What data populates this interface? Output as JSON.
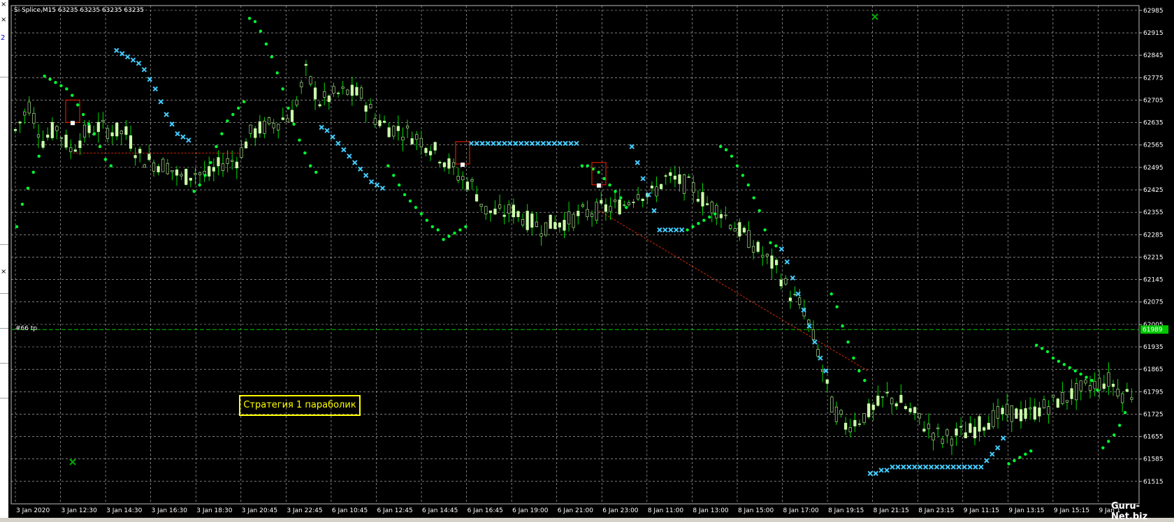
{
  "window": {
    "title": "Si Splice,M15  63235 63235 63235 63235"
  },
  "annotations": {
    "strategy_label": "Стратегия 1 параболик",
    "tp_label": "#66 tp",
    "current_price": "61989",
    "watermark": "Guru-Net.biz"
  },
  "left_strip": {
    "close_marks": [
      "×",
      "×",
      "×"
    ],
    "link_text": "2"
  },
  "colors": {
    "background": "#000000",
    "grid": "#c8c8c8",
    "bull_candle": "#ccffaa",
    "wick": "#00dd00",
    "sar_green": "#00ff33",
    "sar_cyan": "#44ccff",
    "tp_line": "#00c800",
    "order_line": "#ff3300",
    "label_yellow": "#ffff00"
  },
  "chart_data": {
    "type": "candlestick",
    "symbol": "Si Splice",
    "timeframe": "M15",
    "ohlc_header": [
      63235,
      63235,
      63235,
      63235
    ],
    "y_ticks": [
      62985,
      62915,
      62845,
      62775,
      62705,
      62635,
      62565,
      62495,
      62425,
      62355,
      62285,
      62215,
      62145,
      62075,
      62005,
      61935,
      61865,
      61795,
      61725,
      61655,
      61585,
      61515
    ],
    "ylim": [
      61445,
      63000
    ],
    "x_ticks": [
      "3 Jan 2020",
      "3 Jan 12:30",
      "3 Jan 14:30",
      "3 Jan 16:30",
      "3 Jan 18:30",
      "3 Jan 20:45",
      "3 Jan 22:45",
      "6 Jan 10:45",
      "6 Jan 12:45",
      "6 Jan 14:45",
      "6 Jan 16:45",
      "6 Jan 19:00",
      "6 Jan 21:00",
      "6 Jan 23:00",
      "8 Jan 11:00",
      "8 Jan 13:00",
      "8 Jan 15:00",
      "8 Jan 17:00",
      "8 Jan 19:15",
      "8 Jan 21:15",
      "8 Jan 23:15",
      "9 Jan 11:15",
      "9 Jan 13:15",
      "9 Jan 15:15",
      "9 Jan 1"
    ],
    "tp_level": 61989,
    "close_path": [
      62610,
      62690,
      62580,
      62620,
      62550,
      62600,
      62620,
      62610,
      62600,
      62530,
      62510,
      62500,
      62460,
      62480,
      62470,
      62510,
      62520,
      62600,
      62620,
      62640,
      62660,
      62790,
      62700,
      62720,
      62730,
      62720,
      62650,
      62620,
      62610,
      62590,
      62560,
      62520,
      62470,
      62440,
      62360,
      62350,
      62360,
      62330,
      62310,
      62320,
      62330,
      62350,
      62360,
      62370,
      62380,
      62420,
      62410,
      62460,
      62450,
      62430,
      62380,
      62360,
      62310,
      62270,
      62220,
      62180,
      62100,
      62050,
      61920,
      61750,
      61690,
      61710,
      61740,
      61780,
      61760,
      61720,
      61680,
      61650,
      61660,
      61670,
      61700,
      61720,
      61730,
      61720,
      61740,
      61760,
      61780,
      61800,
      61820,
      61830,
      61790
    ],
    "sar_green_segments": [
      [
        [
          62310,
          62380,
          62430,
          62480,
          62530
        ]
      ],
      [
        [
          62780,
          62770,
          62760,
          62750,
          62740,
          62720,
          62690,
          62660,
          62630,
          62600,
          62560,
          62520,
          62500
        ]
      ],
      [
        [
          62420,
          62440,
          62470,
          62510,
          62560,
          62600,
          62640,
          62660,
          62680,
          62700
        ]
      ],
      [
        [
          62960,
          62950,
          62920,
          62880,
          62840,
          62790,
          62740,
          62680,
          62630,
          62580,
          62540,
          62500,
          62480
        ]
      ],
      [
        [
          62500,
          62470,
          62440,
          62410,
          62390,
          62370,
          62350,
          62330,
          62310,
          62300
        ]
      ],
      [
        [
          62270,
          62280,
          62290,
          62300,
          62310
        ]
      ],
      [
        [
          62500,
          62500,
          62490,
          62480,
          62460,
          62440,
          62420,
          62400,
          62370
        ]
      ],
      [
        [
          62300,
          62310,
          62320,
          62330,
          62340,
          62350
        ]
      ],
      [
        [
          62560,
          62550,
          62530,
          62500,
          62470,
          62440,
          62400,
          62360,
          62300,
          62260,
          62250
        ]
      ],
      [
        [
          62100,
          62060,
          62000,
          61950,
          61900,
          61860,
          61830
        ]
      ],
      [
        [
          61570,
          61580,
          61590,
          61600,
          61610
        ]
      ],
      [
        [
          61940,
          61930,
          61920,
          61900,
          61890,
          61880,
          61870,
          61860,
          61850,
          61840,
          61830,
          61800
        ]
      ],
      [
        [
          61620,
          61640,
          61660,
          61690,
          61730
        ]
      ]
    ],
    "sar_cyan_segments": [
      [
        62860,
        62850,
        62840,
        62830,
        62820,
        62800,
        62770,
        62740,
        62700,
        62660,
        62630,
        62600,
        62590,
        62580
      ],
      [
        62620,
        62610,
        62590,
        62570,
        62550,
        62530,
        62510,
        62490,
        62470,
        62450,
        62440,
        62430
      ],
      [
        62570,
        62570,
        62570,
        62570,
        62570,
        62570,
        62570,
        62570,
        62570,
        62570,
        62570,
        62570,
        62570,
        62570,
        62570,
        62570,
        62570,
        62570,
        62570,
        62570
      ],
      [
        62560,
        62510,
        62460,
        62410,
        62360,
        62300,
        62300,
        62300,
        62300,
        62300
      ],
      [
        62240,
        62200,
        62150,
        62100,
        62050,
        62000,
        61950,
        61900,
        61860
      ],
      [
        61540,
        61540,
        61550,
        61550,
        61560,
        61560,
        61560,
        61560,
        61560,
        61560,
        61560,
        61560,
        61560,
        61560,
        61560,
        61560,
        61560,
        61560,
        61560,
        61560,
        61560,
        61580,
        61600,
        61620,
        61650
      ]
    ]
  }
}
